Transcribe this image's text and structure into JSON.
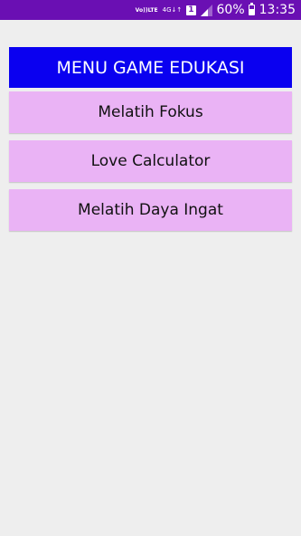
{
  "status_bar": {
    "volte_line1": "Vo))",
    "volte_line2": "LTE",
    "network_line1": "4G",
    "network_line2": "↓↑",
    "sim_slot": "1",
    "battery_percent": "60%",
    "time": "13:35"
  },
  "header": {
    "title": "MENU GAME EDUKASI"
  },
  "menu": {
    "items": [
      {
        "label": "Melatih Fokus"
      },
      {
        "label": "Love Calculator"
      },
      {
        "label": "Melatih Daya Ingat"
      }
    ]
  },
  "colors": {
    "status_bar_bg": "#6a0fb3",
    "title_bg": "#0a00f0",
    "button_bg": "#eab3f5",
    "page_bg": "#eeeeee"
  }
}
